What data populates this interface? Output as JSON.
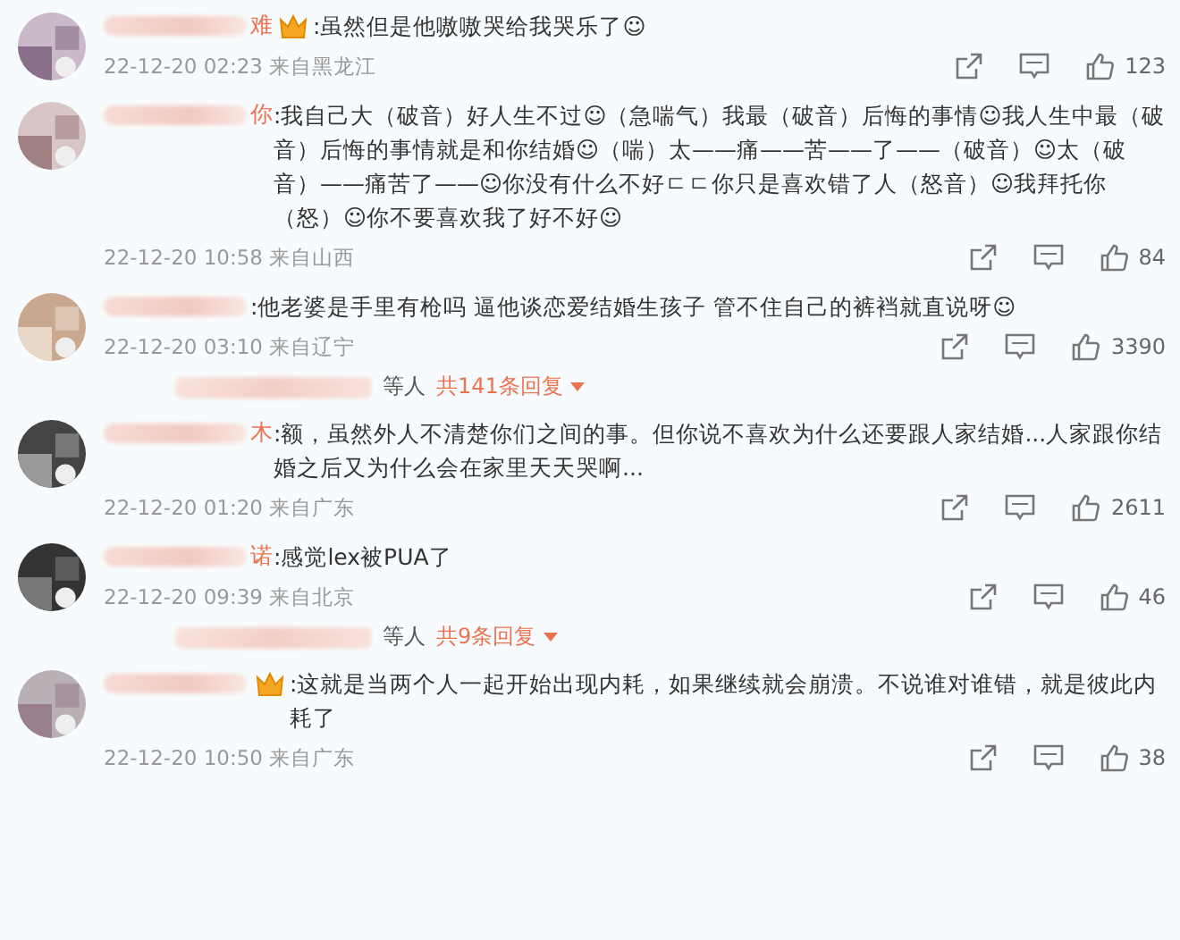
{
  "comments": [
    {
      "name_tail": "难",
      "vip": true,
      "text": ":虽然但是他嗷嗷哭给我哭乐了☺",
      "meta": "22-12-20 02:23 来自黑龙江",
      "likes": "123"
    },
    {
      "name_tail": "你",
      "vip": false,
      "text": ":我自己大（破音）好人生不过☺（急喘气）我最（破音）后悔的事情☺我人生中最（破音）后悔的事情就是和你结婚☺（喘）太——痛——苦——了——（破音）☺太（破音）——痛苦了——☺你没有什么不好ㄷㄷ你只是喜欢错了人（怒音）☺我拜托你（怒）☺你不要喜欢我了好不好☺",
      "meta": "22-12-20 10:58 来自山西",
      "likes": "84"
    },
    {
      "vip": false,
      "text": ":他老婆是手里有枪吗 逼他谈恋爱结婚生孩子 管不住自己的裤裆就直说呀☺",
      "meta": "22-12-20 03:10 来自辽宁",
      "likes": "3390",
      "replies": {
        "suffix": "等人",
        "count": "共141条回复"
      }
    },
    {
      "name_tail": "木",
      "vip": false,
      "text": ":额，虽然外人不清楚你们之间的事。但你说不喜欢为什么还要跟人家结婚...人家跟你结婚之后又为什么会在家里天天哭啊...",
      "meta": "22-12-20 01:20 来自广东",
      "likes": "2611"
    },
    {
      "name_tail": "诺",
      "vip": false,
      "text": ":感觉lex被PUA了",
      "meta": "22-12-20 09:39 来自北京",
      "likes": "46",
      "replies": {
        "suffix": "等人",
        "count": "共9条回复"
      }
    },
    {
      "vip": true,
      "text": ":这就是当两个人一起开始出现内耗，如果继续就会崩溃。不说谁对谁错，就是彼此内耗了",
      "meta": "22-12-20 10:50 来自广东",
      "likes": "38"
    }
  ]
}
